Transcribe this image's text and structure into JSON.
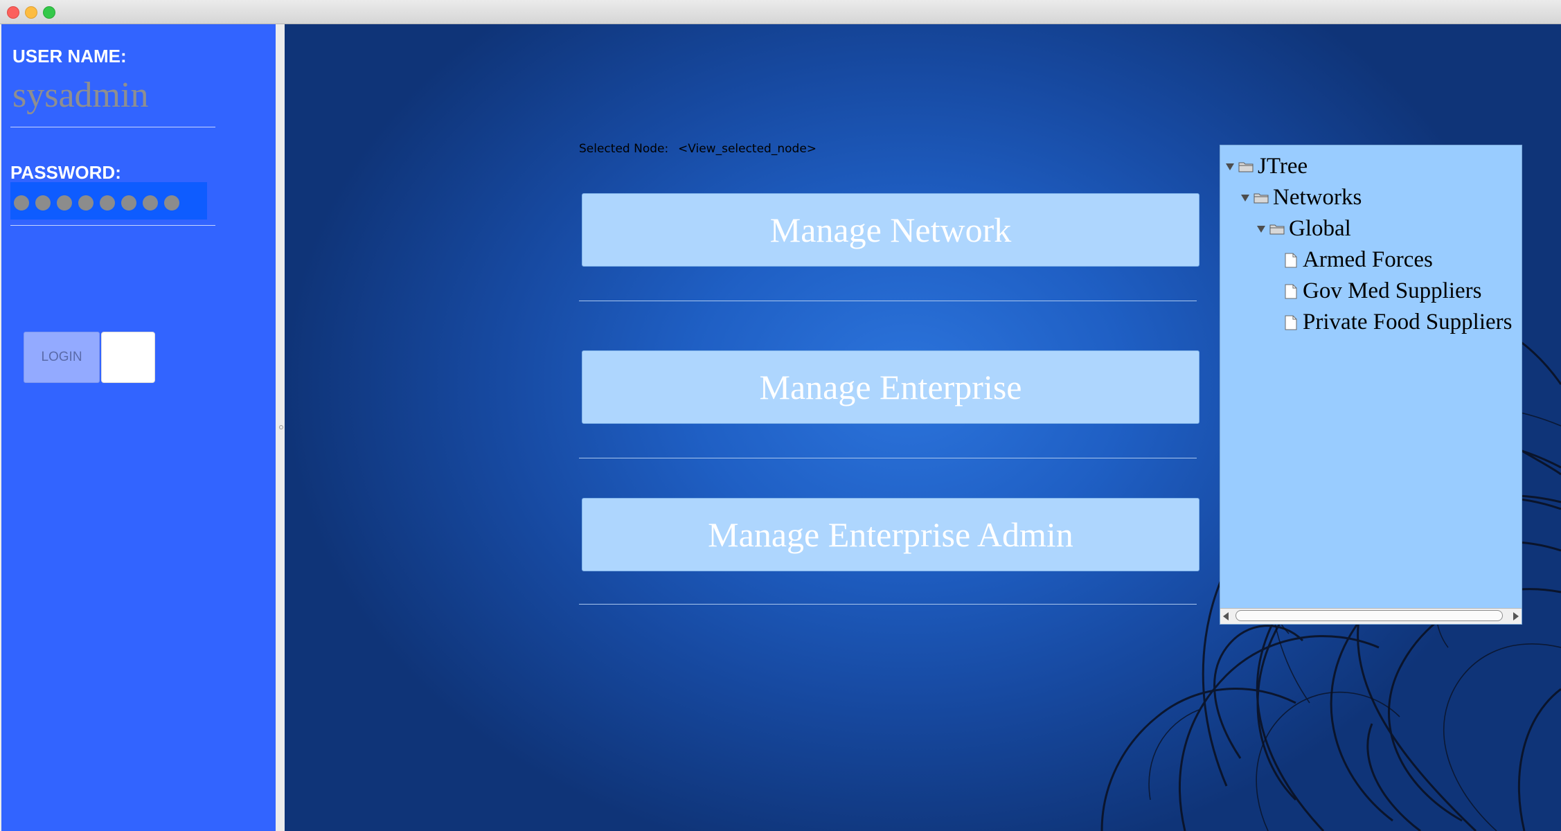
{
  "left_panel": {
    "username_label": "USER NAME:",
    "username_value": "sysadmin",
    "password_label": "PASSWORD:",
    "password_mask_count": 8,
    "login_button": "LOGIN"
  },
  "main": {
    "selected_node_label": "Selected Node:",
    "selected_node_value": "<View_selected_node>",
    "buttons": [
      "Manage Network",
      "Manage Enterprise",
      "Manage Enterprise Admin"
    ]
  },
  "tree": {
    "nodes": [
      {
        "label": "JTree",
        "type": "folder",
        "expanded": true,
        "depth": 0
      },
      {
        "label": "Networks",
        "type": "folder",
        "expanded": true,
        "depth": 1
      },
      {
        "label": "Global",
        "type": "folder",
        "expanded": true,
        "depth": 2
      },
      {
        "label": "Armed Forces",
        "type": "leaf",
        "depth": 3
      },
      {
        "label": "Gov Med Suppliers",
        "type": "leaf",
        "depth": 3
      },
      {
        "label": "Private Food Suppliers",
        "type": "leaf",
        "depth": 3
      }
    ]
  },
  "colors": {
    "left_panel_bg": "#3264ff",
    "password_field_bg": "#0e5cff",
    "button_bg": "#aed6fe",
    "tree_bg": "#99ccff"
  }
}
